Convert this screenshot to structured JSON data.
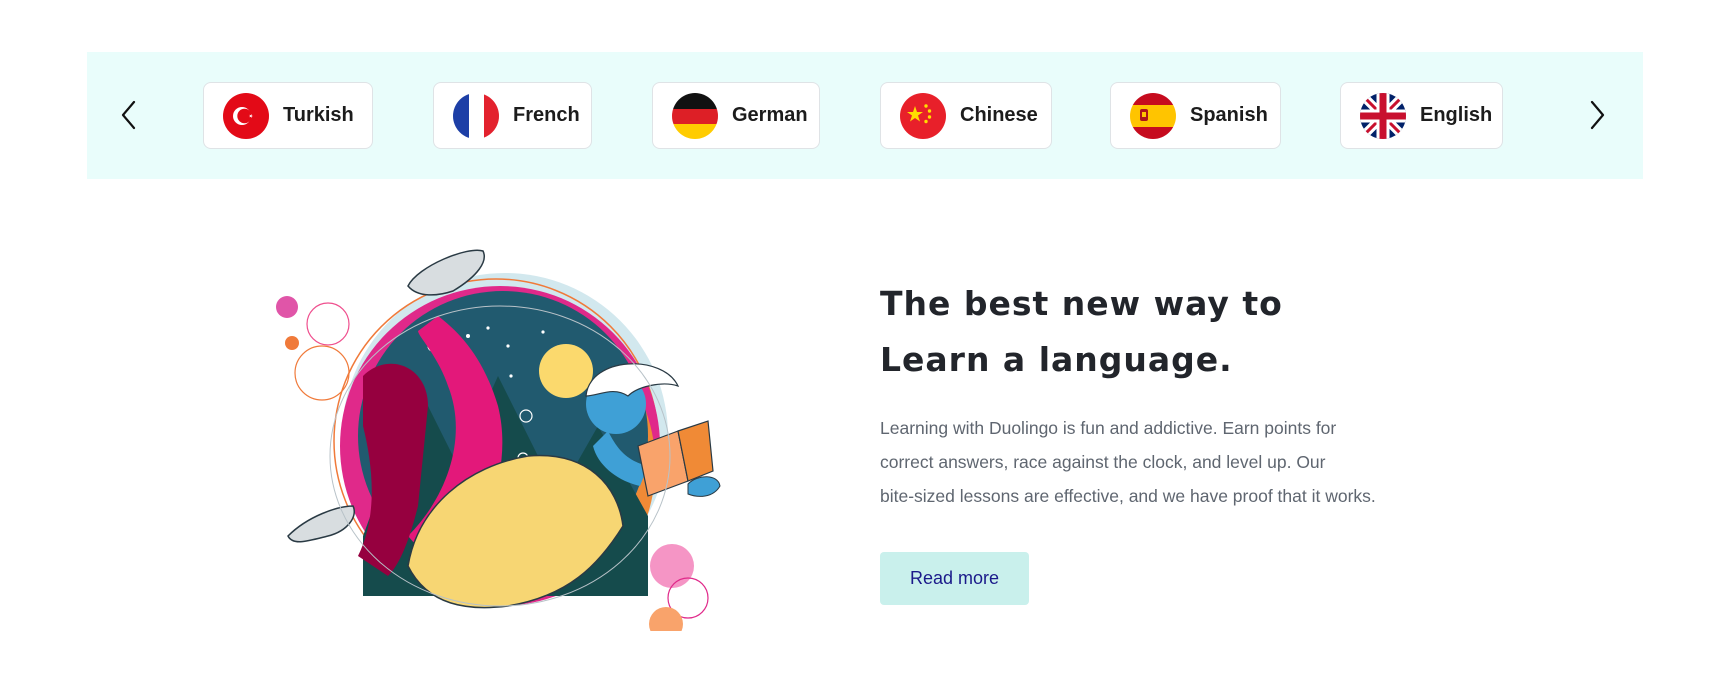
{
  "carousel": {
    "prev_icon": "chevron-left-icon",
    "next_icon": "chevron-right-icon",
    "background": "#e9fdfb",
    "languages": [
      {
        "label": "Turkish",
        "flag": "turkey-flag-icon"
      },
      {
        "label": "French",
        "flag": "france-flag-icon"
      },
      {
        "label": "German",
        "flag": "germany-flag-icon"
      },
      {
        "label": "Chinese",
        "flag": "china-flag-icon"
      },
      {
        "label": "Spanish",
        "flag": "spain-flag-icon"
      },
      {
        "label": "English",
        "flag": "uk-flag-icon"
      }
    ]
  },
  "hero": {
    "title_line1": "The best new way to",
    "title_line2": "Learn a language.",
    "body_line1": "Learning with Duolingo is fun and addictive. Earn points for",
    "body_line2": "correct answers, race against the clock, and level up. Our",
    "body_line3": "bite-sized lessons are effective, and we have proof that it works.",
    "cta_label": "Read more",
    "cta_color": "#c9f0ec"
  }
}
